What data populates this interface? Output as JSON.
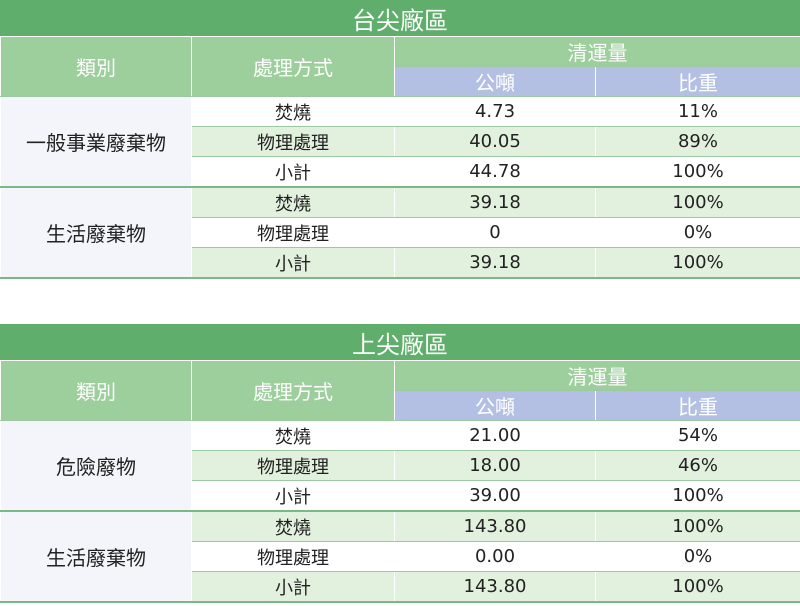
{
  "sections": [
    {
      "title": "台尖廠區",
      "headers": {
        "category": "類別",
        "method": "處理方式",
        "volume": "清運量",
        "tons": "公噸",
        "ratio": "比重"
      },
      "groups": [
        {
          "category": "一般事業廢棄物",
          "rows": [
            {
              "method": "焚燒",
              "tons": "4.73",
              "ratio": "11%"
            },
            {
              "method": "物理處理",
              "tons": "40.05",
              "ratio": "89%"
            },
            {
              "method": "小計",
              "tons": "44.78",
              "ratio": "100%"
            }
          ]
        },
        {
          "category": "生活廢棄物",
          "rows": [
            {
              "method": "焚燒",
              "tons": "39.18",
              "ratio": "100%"
            },
            {
              "method": "物理處理",
              "tons": "0",
              "ratio": "0%"
            },
            {
              "method": "小計",
              "tons": "39.18",
              "ratio": "100%"
            }
          ]
        }
      ]
    },
    {
      "title": "上尖廠區",
      "headers": {
        "category": "類別",
        "method": "處理方式",
        "volume": "清運量",
        "tons": "公噸",
        "ratio": "比重"
      },
      "groups": [
        {
          "category": "危險廢物",
          "rows": [
            {
              "method": "焚燒",
              "tons": "21.00",
              "ratio": "54%"
            },
            {
              "method": "物理處理",
              "tons": "18.00",
              "ratio": "46%"
            },
            {
              "method": "小計",
              "tons": "39.00",
              "ratio": "100%"
            }
          ]
        },
        {
          "category": "生活廢棄物",
          "rows": [
            {
              "method": "焚燒",
              "tons": "143.80",
              "ratio": "100%"
            },
            {
              "method": "物理處理",
              "tons": "0.00",
              "ratio": "0%"
            },
            {
              "method": "小計",
              "tons": "143.80",
              "ratio": "100%"
            }
          ]
        }
      ]
    }
  ]
}
